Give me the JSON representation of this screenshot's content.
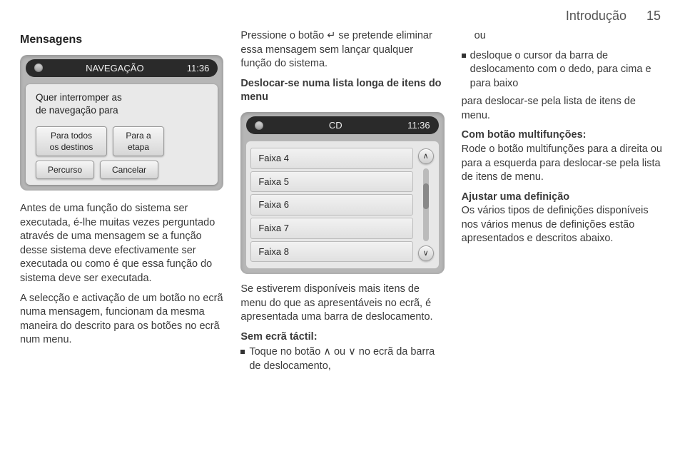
{
  "header": {
    "title": "Introdução",
    "page": "15"
  },
  "col1": {
    "heading": "Mensagens",
    "screenshot": {
      "nav_title": "NAVEGAÇÃO",
      "clock": "11:36",
      "msg_line1": "Quer interromper as",
      "msg_line2": "de navegação para",
      "btn_all": "Para todos\nos destinos",
      "btn_step": "Para a\netapa",
      "btn_route": "Percurso",
      "btn_cancel": "Cancelar"
    },
    "p1": "Antes de uma função do sistema ser executada, é-lhe muitas vezes perguntado através de uma mensagem se a função desse sistema deve efectivamente ser executada ou como é que essa função do sistema deve ser executada.",
    "p2": "A selecção e activação de um botão no ecrã numa mensagem, funcionam da mesma maneira do descrito para os botões no ecrã num menu."
  },
  "col2": {
    "p1_a": "Pressione o botão ",
    "p1_glyph": "↵",
    "p1_b": " se pretende eliminar essa mensagem sem lançar qualquer função do sistema.",
    "h1": "Deslocar-se numa lista longa de itens do menu",
    "screenshot": {
      "cd_title": "CD",
      "clock": "11:36",
      "tracks": [
        "Faixa 4",
        "Faixa 5",
        "Faixa 6",
        "Faixa 7",
        "Faixa 8"
      ]
    },
    "p2": "Se estiverem disponíveis mais itens de menu do que as apresentáveis no ecrã, é apresentada uma barra de deslocamento.",
    "h2": "Sem ecrã táctil:",
    "bullet_a": "Toque no botão ",
    "bullet_up": "∧",
    "bullet_mid": " ou ",
    "bullet_down": "∨",
    "bullet_b": " no ecrã da barra de deslocamento,"
  },
  "col3": {
    "or": "ou",
    "bullet1": "desloque o cursor da barra de deslocamento com o dedo, para cima e para baixo",
    "p1": "para deslocar-se pela lista de itens de menu.",
    "h1": "Com botão multifunções:",
    "p2": "Rode o botão multifunções para a direita ou para a esquerda para deslocar-se pela lista de itens de menu.",
    "h2": "Ajustar uma definição",
    "p3": "Os vários tipos de definições disponíveis nos vários menus de definições estão apresentados e descritos abaixo."
  }
}
